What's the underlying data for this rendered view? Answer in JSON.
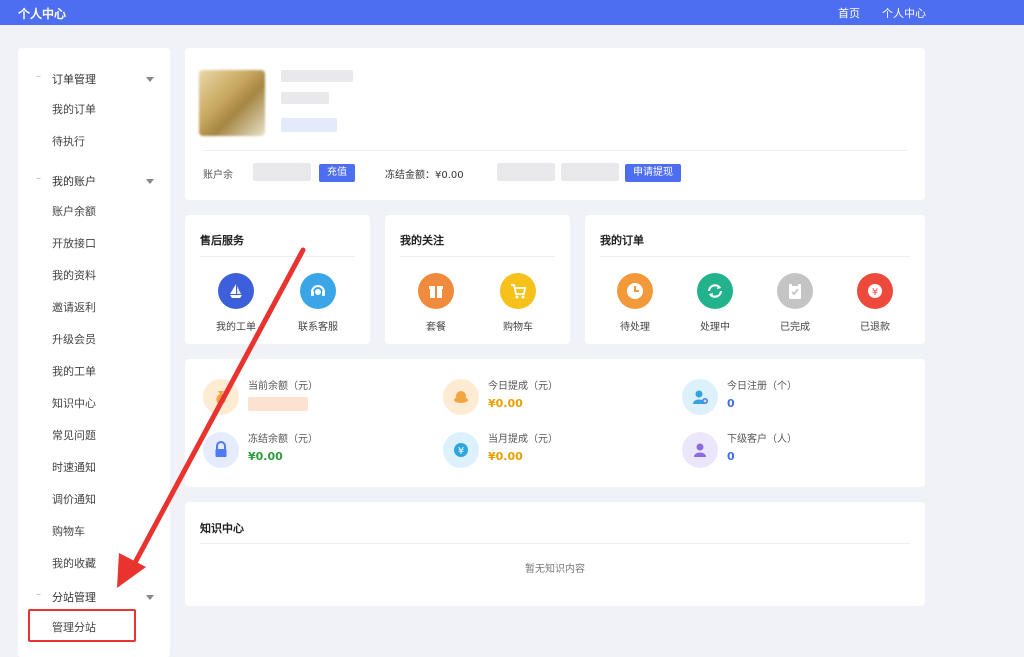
{
  "header": {
    "title": "个人中心",
    "nav_home": "首页",
    "nav_profile": "个人中心",
    "bg_color": "#4e6ef2"
  },
  "sidebar": {
    "groups": [
      {
        "label": "订单管理",
        "items": [
          "我的订单",
          "待执行"
        ]
      },
      {
        "label": "我的账户",
        "items": [
          "账户余额",
          "开放接口",
          "我的资料",
          "邀请返利",
          "升级会员",
          "我的工单",
          "知识中心",
          "常见问题",
          "时速通知",
          "调价通知",
          "购物车",
          "我的收藏"
        ]
      },
      {
        "label": "分站管理",
        "items": [
          "管理分站"
        ]
      }
    ],
    "dash": "–"
  },
  "account": {
    "balance_label": "账户余",
    "recharge_button": "充值",
    "frozen_label": "冻结金额：¥0.00",
    "withdraw_button": "申请提现"
  },
  "after_sales": {
    "title": "售后服务",
    "items": [
      {
        "label": "我的工单",
        "icon": "ship-icon",
        "color": "#3d5fd9"
      },
      {
        "label": "联系客服",
        "icon": "headset-icon",
        "color": "#3aa6e8"
      }
    ]
  },
  "follow": {
    "title": "我的关注",
    "items": [
      {
        "label": "套餐",
        "icon": "gift-icon",
        "color": "#f08a3c"
      },
      {
        "label": "购物车",
        "icon": "cart-icon",
        "color": "#f5c11a"
      }
    ]
  },
  "orders": {
    "title": "我的订单",
    "items": [
      {
        "label": "待处理",
        "icon": "clock-icon",
        "color": "#f29a3b"
      },
      {
        "label": "处理中",
        "icon": "refresh-icon",
        "color": "#22b28c"
      },
      {
        "label": "已完成",
        "icon": "clipboard-check-icon",
        "color": "#c4c4c4"
      },
      {
        "label": "已退款",
        "icon": "refund-icon",
        "color": "#ee4a3c"
      }
    ]
  },
  "stats": [
    {
      "label": "当前余额（元）",
      "value": "",
      "icon": "money-bag-icon",
      "bg": "#fdebd3",
      "fg": "#f2a541",
      "color": "#f2a541"
    },
    {
      "label": "今日提成（元）",
      "value": "¥0.00",
      "icon": "coin-icon",
      "bg": "#fdebd3",
      "fg": "#f2a541",
      "color": "#e8a000"
    },
    {
      "label": "今日注册（个）",
      "value": "0",
      "icon": "user-add-icon",
      "bg": "#dcf1fb",
      "fg": "#2fa5e0",
      "color": "#3d6ff0"
    },
    {
      "label": "冻结余额（元）",
      "value": "¥0.00",
      "icon": "lock-icon",
      "bg": "#e4ecfd",
      "fg": "#4e7bf3",
      "color": "#2e9d3c"
    },
    {
      "label": "当月提成（元）",
      "value": "¥0.00",
      "icon": "yen-coin-icon",
      "bg": "#dcf1fb",
      "fg": "#2fa5e0",
      "color": "#e8a000"
    },
    {
      "label": "下级客户（人）",
      "value": "0",
      "icon": "user-icon",
      "bg": "#ece6fb",
      "fg": "#8b6be0",
      "color": "#3d6ff0"
    }
  ],
  "knowledge": {
    "title": "知识中心",
    "empty_text": "暂无知识内容"
  },
  "annotation_color": "#e8332f"
}
